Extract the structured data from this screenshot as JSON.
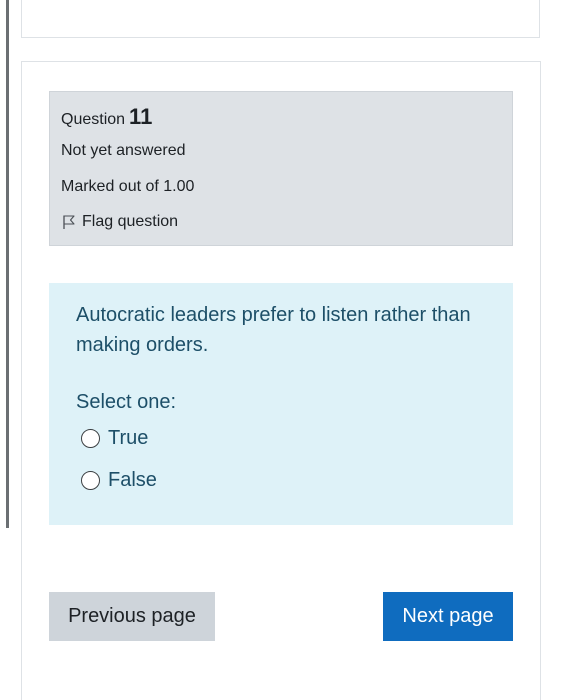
{
  "question": {
    "prefix": "Question",
    "number": "11",
    "state": "Not yet answered",
    "grade": "Marked out of 1.00",
    "flag_label": "Flag question",
    "flag_icon": "flag-icon",
    "text": "Autocratic leaders prefer to listen rather than making orders.",
    "prompt": "Select one:",
    "options": [
      {
        "label": "True",
        "selected": false
      },
      {
        "label": "False",
        "selected": false
      }
    ]
  },
  "navigation": {
    "previous_label": "Previous page",
    "next_label": "Next page"
  },
  "colors": {
    "info_bg": "#dee2e6",
    "content_bg": "#def2f8",
    "content_text": "#1d4f68",
    "next_button": "#0f6cbf",
    "previous_button": "#ced4da"
  }
}
